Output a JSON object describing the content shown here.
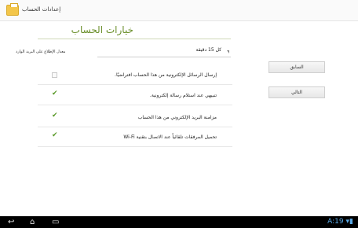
{
  "titlebar": {
    "title": "إعدادات الحساب",
    "icon": "settings-account-icon"
  },
  "page": {
    "heading": "خيارات الحساب"
  },
  "frequency": {
    "label": "معدل الإطلاع على البريد الوارد",
    "value": "كل 15 دقيقة"
  },
  "options": [
    {
      "label": "إرسال الرسائل الإلكترونية من هذا الحساب افتراضيًا.",
      "checked": false
    },
    {
      "label": "تنبيهي عند استلام رسالة إلكترونية.",
      "checked": true
    },
    {
      "label": "مزامنة البريد الإلكتروني من هذا الحساب",
      "checked": true
    },
    {
      "label": "تحميل المرفقات تلقائياً عند الاتصال بتقنية Wi-Fi",
      "checked": true
    }
  ],
  "buttons": {
    "previous": "السابق",
    "next": "التالي"
  },
  "statusbar": {
    "time": "A:19",
    "accent": "#5aa9e6"
  },
  "theme": {
    "accent": "#6a8f2a",
    "check_color": "#5b9a2a"
  }
}
